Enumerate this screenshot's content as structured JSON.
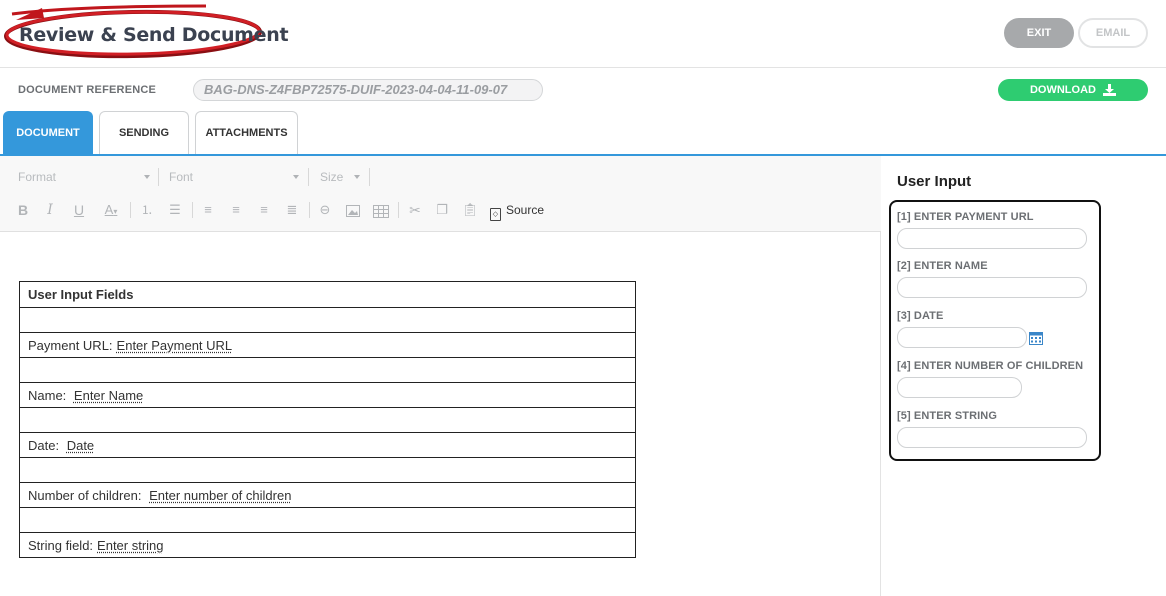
{
  "header": {
    "title": "Review & Send Document",
    "exit_label": "EXIT",
    "email_label": "EMAIL"
  },
  "reference": {
    "label": "DOCUMENT REFERENCE",
    "value": "BAG-DNS-Z4FBP72575-DUIF-2023-04-04-11-09-07",
    "download_label": "DOWNLOAD"
  },
  "tabs": [
    {
      "label": "DOCUMENT",
      "active": true
    },
    {
      "label": "SENDING",
      "active": false
    },
    {
      "label": "ATTACHMENTS",
      "active": false
    }
  ],
  "toolbar": {
    "format_label": "Format",
    "font_label": "Font",
    "size_label": "Size",
    "source_label": "Source",
    "buttons": [
      "bold-icon",
      "italic-icon",
      "underline-icon",
      "text-color-icon",
      "numbered-list-icon",
      "bulleted-list-icon",
      "align-left-icon",
      "align-center-icon",
      "align-right-icon",
      "justify-icon",
      "link-icon",
      "image-icon",
      "table-icon",
      "cut-icon",
      "copy-icon",
      "paste-icon",
      "source-icon"
    ]
  },
  "document": {
    "header": "User Input Fields",
    "rows": [
      {
        "label": "Payment URL:",
        "placeholder": "Enter Payment URL"
      },
      {
        "label": "Name:",
        "placeholder": "Enter Name"
      },
      {
        "label": "Date:",
        "placeholder": "Date"
      },
      {
        "label": "Number of children:",
        "placeholder": "Enter number of children"
      },
      {
        "label": "String field:",
        "placeholder": "Enter string"
      }
    ]
  },
  "user_input": {
    "title": "User Input",
    "fields": [
      {
        "label": "[1] ENTER PAYMENT URL",
        "value": ""
      },
      {
        "label": "[2] ENTER NAME",
        "value": ""
      },
      {
        "label": "[3] DATE",
        "value": ""
      },
      {
        "label": "[4] ENTER NUMBER OF CHILDREN",
        "value": ""
      },
      {
        "label": "[5] ENTER STRING",
        "value": ""
      }
    ]
  },
  "colors": {
    "accent": "#3498db",
    "download": "#2ecc71",
    "exit": "#a7a9ab",
    "highlight_ring": "#c0161c"
  }
}
